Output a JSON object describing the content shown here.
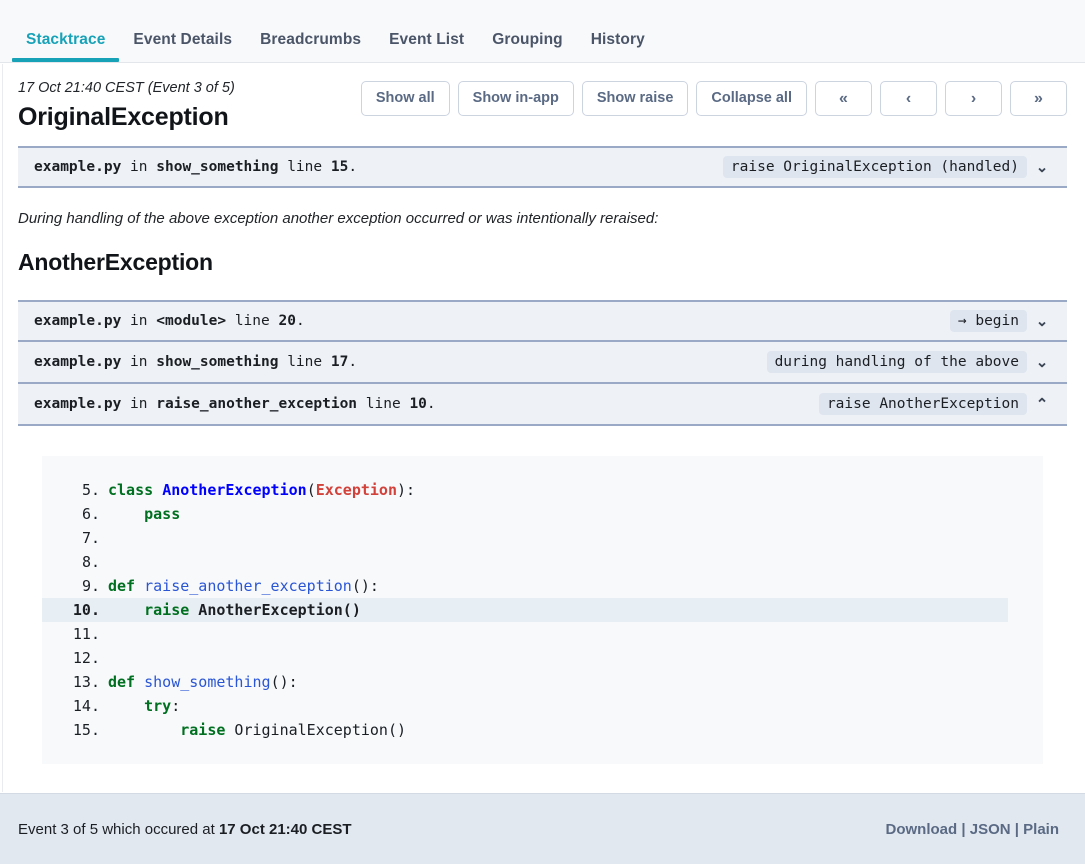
{
  "tabs": [
    {
      "label": "Stacktrace",
      "active": true
    },
    {
      "label": "Event Details",
      "active": false
    },
    {
      "label": "Breadcrumbs",
      "active": false
    },
    {
      "label": "Event List",
      "active": false
    },
    {
      "label": "Grouping",
      "active": false
    },
    {
      "label": "History",
      "active": false
    }
  ],
  "header": {
    "event_meta": "17 Oct 21:40 CEST (Event 3 of 5)",
    "exception_title": "OriginalException",
    "buttons": [
      {
        "label": "Show all",
        "name": "show-all-button"
      },
      {
        "label": "Show in-app",
        "name": "show-in-app-button"
      },
      {
        "label": "Show raise",
        "name": "show-raise-button"
      },
      {
        "label": "Collapse all",
        "name": "collapse-all-button"
      }
    ],
    "nav_buttons": [
      {
        "label": "«",
        "name": "first-event-button"
      },
      {
        "label": "‹",
        "name": "previous-event-button"
      },
      {
        "label": "›",
        "name": "next-event-button"
      },
      {
        "label": "»",
        "name": "last-event-button"
      }
    ]
  },
  "first_exception": {
    "frame": {
      "file": "example.py",
      "in": "in",
      "function": "show_something",
      "line_word": "line",
      "line_no": "15",
      "trailing": ".",
      "badge": "raise OriginalException (handled)",
      "chevron": "⌄"
    }
  },
  "during_note": "During handling of the above exception another exception occurred or was intentionally reraised:",
  "second_exception": {
    "title": "AnotherException",
    "frames": [
      {
        "file": "example.py",
        "in": "in",
        "function": "<module>",
        "line_word": "line",
        "line_no": "20",
        "trailing": ".",
        "badge": "→ begin",
        "chevron": "⌄",
        "expanded": false
      },
      {
        "file": "example.py",
        "in": "in",
        "function": "show_something",
        "line_word": "line",
        "line_no": "17",
        "trailing": ".",
        "badge": "during handling of the above",
        "chevron": "⌄",
        "expanded": false
      },
      {
        "file": "example.py",
        "in": "in",
        "function": "raise_another_exception",
        "line_word": "line",
        "line_no": "10",
        "trailing": ".",
        "badge": "raise AnotherException",
        "chevron": "⌃",
        "expanded": true
      }
    ]
  },
  "code": {
    "highlight_line": "10",
    "lines": [
      {
        "no": "5.",
        "tokens": [
          {
            "t": "class ",
            "c": "kw"
          },
          {
            "t": "AnotherException",
            "c": "cls"
          },
          {
            "t": "(",
            "c": "pl"
          },
          {
            "t": "Exception",
            "c": "exc"
          },
          {
            "t": "):",
            "c": "pl"
          }
        ]
      },
      {
        "no": "6.",
        "tokens": [
          {
            "t": "    ",
            "c": "pl"
          },
          {
            "t": "pass",
            "c": "kw"
          }
        ]
      },
      {
        "no": "7.",
        "tokens": [
          {
            "t": "",
            "c": "pl"
          }
        ]
      },
      {
        "no": "8.",
        "tokens": [
          {
            "t": "",
            "c": "pl"
          }
        ]
      },
      {
        "no": "9.",
        "tokens": [
          {
            "t": "def ",
            "c": "kw"
          },
          {
            "t": "raise_another_exception",
            "c": "fn"
          },
          {
            "t": "():",
            "c": "pl"
          }
        ]
      },
      {
        "no": "10.",
        "tokens": [
          {
            "t": "    ",
            "c": "pl"
          },
          {
            "t": "raise",
            "c": "kw"
          },
          {
            "t": " AnotherException()",
            "c": "pl"
          }
        ],
        "highlight": true
      },
      {
        "no": "11.",
        "tokens": [
          {
            "t": "",
            "c": "pl"
          }
        ]
      },
      {
        "no": "12.",
        "tokens": [
          {
            "t": "",
            "c": "pl"
          }
        ]
      },
      {
        "no": "13.",
        "tokens": [
          {
            "t": "def ",
            "c": "kw"
          },
          {
            "t": "show_something",
            "c": "fn"
          },
          {
            "t": "():",
            "c": "pl"
          }
        ]
      },
      {
        "no": "14.",
        "tokens": [
          {
            "t": "    ",
            "c": "pl"
          },
          {
            "t": "try",
            "c": "kw"
          },
          {
            "t": ":",
            "c": "pl"
          }
        ]
      },
      {
        "no": "15.",
        "tokens": [
          {
            "t": "        ",
            "c": "pl"
          },
          {
            "t": "raise",
            "c": "kw"
          },
          {
            "t": " OriginalException()",
            "c": "pl"
          }
        ]
      }
    ]
  },
  "footer": {
    "text_prefix": "Event 3 of 5 which occured at ",
    "timestamp": "17 Oct 21:40 CEST",
    "links": [
      {
        "label": "Download",
        "name": "download-link"
      },
      {
        "label": "JSON",
        "name": "json-link"
      },
      {
        "label": "Plain",
        "name": "plain-link"
      }
    ],
    "separator": " | "
  }
}
